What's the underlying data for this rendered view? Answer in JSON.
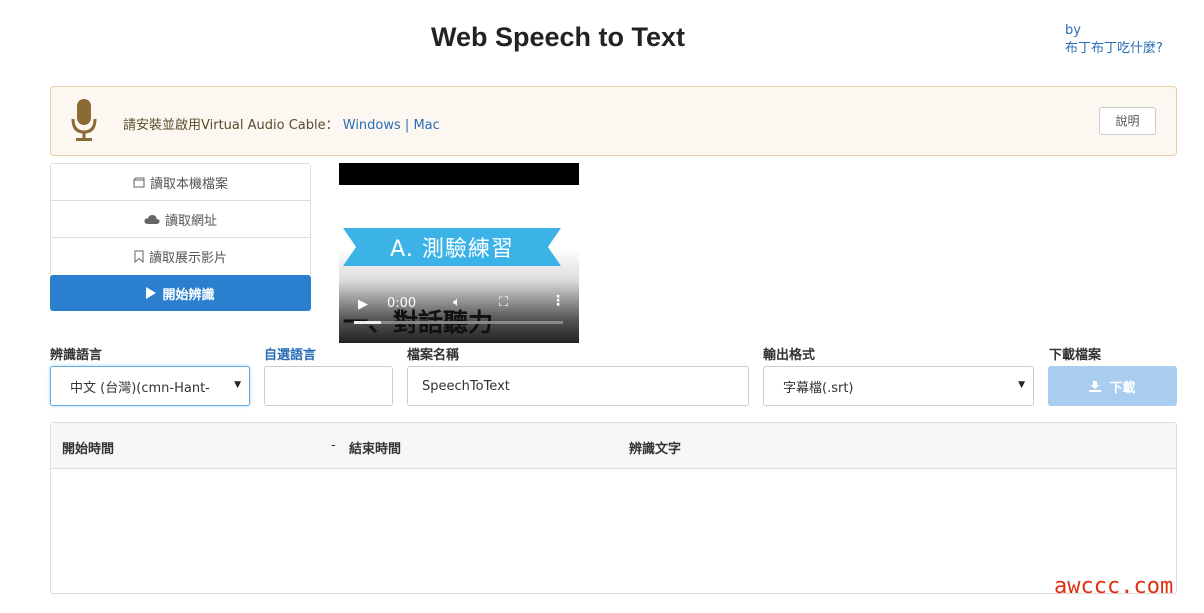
{
  "header": {
    "title": "Web Speech to Text",
    "by_label": "by",
    "author_link": "布丁布丁吃什麼?"
  },
  "notice": {
    "text": "請安裝並啟用Virtual Audio Cable：",
    "windows_link": "Windows",
    "separator": "|",
    "mac_link": "Mac",
    "help_button": "說明",
    "icon": "microphone-icon",
    "bg_color": "#fcf8f1"
  },
  "source_menu": {
    "items": [
      {
        "label": "讀取本機檔案",
        "icon": "folder-icon"
      },
      {
        "label": "讀取網址",
        "icon": "cloud-icon"
      },
      {
        "label": "讀取展示影片",
        "icon": "bookmark-icon"
      }
    ],
    "start_button": "開始辨識",
    "start_color": "#2a7fcf"
  },
  "video": {
    "banner_text": "A. 測驗練習",
    "caption_text": "一、對話聽力",
    "time": "0:00",
    "progress": 0.13
  },
  "form": {
    "language_label": "辨識語言",
    "language_value": "中文 (台灣)(cmn-Hant-",
    "custom_language_label": "自選語言",
    "custom_language_value": "",
    "filename_label": "檔案名稱",
    "filename_value": "SpeechToText",
    "format_label": "輸出格式",
    "format_value": "字幕檔(.srt)",
    "download_label": "下載檔案",
    "download_button": "下載"
  },
  "table": {
    "col_start": "開始時間",
    "col_sep": "-",
    "col_end": "結束時間",
    "col_text": "辨識文字",
    "rows": []
  },
  "watermark": "awccc.com"
}
